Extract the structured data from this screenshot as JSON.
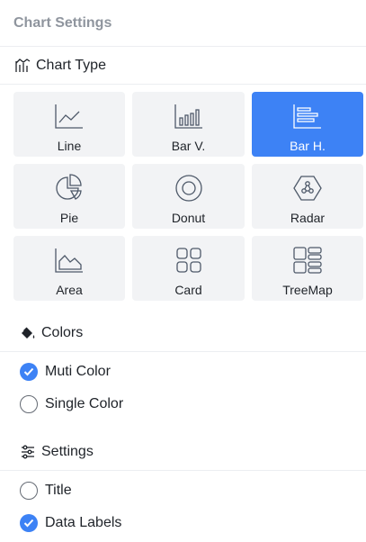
{
  "panel": {
    "title": "Chart Settings"
  },
  "chart_type": {
    "label": "Chart Type",
    "icon": "chart-type-icon",
    "tiles": [
      {
        "label": "Line",
        "icon": "line-chart-icon",
        "selected": false
      },
      {
        "label": "Bar V.",
        "icon": "bar-vertical-icon",
        "selected": false
      },
      {
        "label": "Bar H.",
        "icon": "bar-horizontal-icon",
        "selected": true
      },
      {
        "label": "Pie",
        "icon": "pie-chart-icon",
        "selected": false
      },
      {
        "label": "Donut",
        "icon": "donut-chart-icon",
        "selected": false
      },
      {
        "label": "Radar",
        "icon": "radar-chart-icon",
        "selected": false
      },
      {
        "label": "Area",
        "icon": "area-chart-icon",
        "selected": false
      },
      {
        "label": "Card",
        "icon": "card-icon",
        "selected": false
      },
      {
        "label": "TreeMap",
        "icon": "treemap-icon",
        "selected": false
      }
    ]
  },
  "colors": {
    "label": "Colors",
    "icon": "paint-bucket-icon",
    "options": [
      {
        "label": "Muti Color",
        "checked": true
      },
      {
        "label": "Single Color",
        "checked": false
      }
    ]
  },
  "settings": {
    "label": "Settings",
    "icon": "sliders-icon",
    "options": [
      {
        "label": "Title",
        "checked": false
      },
      {
        "label": "Data Labels",
        "checked": true
      }
    ]
  },
  "theme": {
    "accent": "#3d82f5",
    "tile_bg": "#f2f3f5",
    "muted": "#8f959e"
  }
}
